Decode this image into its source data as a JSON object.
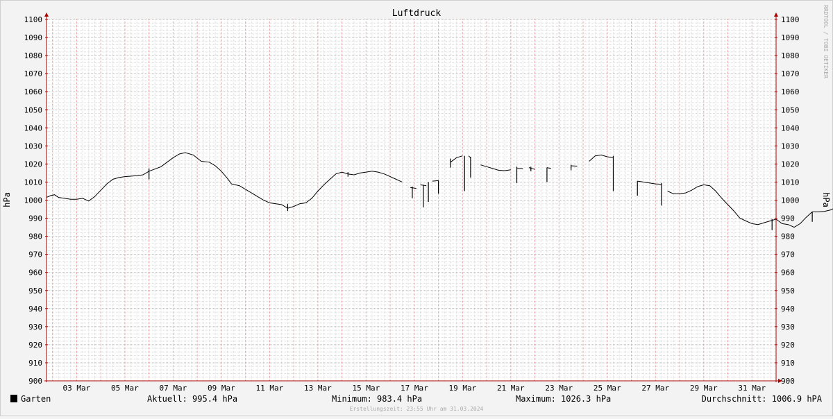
{
  "chart_data": {
    "type": "line",
    "title": "Luftdruck",
    "ylabel": "hPa",
    "ylim": [
      900,
      1100
    ],
    "yticks": [
      900,
      910,
      920,
      930,
      940,
      950,
      960,
      970,
      980,
      990,
      1000,
      1010,
      1020,
      1030,
      1040,
      1050,
      1060,
      1070,
      1080,
      1090,
      1100
    ],
    "xlim": [
      "2024-03-01T18:00",
      "2024-03-31T24:00"
    ],
    "xticks": [
      {
        "date": "2024-03-03",
        "label": "03 Mar"
      },
      {
        "date": "2024-03-05",
        "label": "05 Mar"
      },
      {
        "date": "2024-03-07",
        "label": "07 Mar"
      },
      {
        "date": "2024-03-09",
        "label": "09 Mar"
      },
      {
        "date": "2024-03-11",
        "label": "11 Mar"
      },
      {
        "date": "2024-03-13",
        "label": "13 Mar"
      },
      {
        "date": "2024-03-15",
        "label": "15 Mar"
      },
      {
        "date": "2024-03-17",
        "label": "17 Mar"
      },
      {
        "date": "2024-03-19",
        "label": "19 Mar"
      },
      {
        "date": "2024-03-21",
        "label": "21 Mar"
      },
      {
        "date": "2024-03-23",
        "label": "23 Mar"
      },
      {
        "date": "2024-03-25",
        "label": "25 Mar"
      },
      {
        "date": "2024-03-27",
        "label": "27 Mar"
      },
      {
        "date": "2024-03-29",
        "label": "29 Mar"
      },
      {
        "date": "2024-03-31",
        "label": "31 Mar"
      }
    ],
    "grid": true,
    "legend_position": "bottom-left",
    "series": [
      {
        "name": "Garten",
        "color": "#000000",
        "segments": [
          [
            [
              "2024-03-01T18:00",
              1001.5
            ],
            [
              "2024-03-01T22:00",
              1002.5
            ],
            [
              "2024-03-02T02:00",
              1003
            ],
            [
              "2024-03-02T06:00",
              1001.5
            ],
            [
              "2024-03-02T12:00",
              1001
            ],
            [
              "2024-03-02T18:00",
              1000.5
            ],
            [
              "2024-03-03T00:00",
              1000.5
            ],
            [
              "2024-03-03T06:00",
              1001
            ],
            [
              "2024-03-03T12:00",
              999.5
            ],
            [
              "2024-03-03T18:00",
              1002
            ],
            [
              "2024-03-04T00:00",
              1005.5
            ],
            [
              "2024-03-04T06:00",
              1009
            ],
            [
              "2024-03-04T12:00",
              1011.5
            ],
            [
              "2024-03-04T18:00",
              1012.5
            ],
            [
              "2024-03-05T00:00",
              1013
            ],
            [
              "2024-03-05T12:00",
              1013.5
            ],
            [
              "2024-03-05T18:00",
              1014
            ],
            [
              "2024-03-06T00:00",
              1016
            ],
            [
              "2024-03-06T12:00",
              1018.5
            ],
            [
              "2024-03-06T18:00",
              1021
            ],
            [
              "2024-03-07T00:00",
              1023.5
            ],
            [
              "2024-03-07T06:00",
              1025.5
            ],
            [
              "2024-03-07T12:00",
              1026.3
            ],
            [
              "2024-03-07T20:00",
              1025
            ],
            [
              "2024-03-08T04:00",
              1021.5
            ],
            [
              "2024-03-08T12:00",
              1021
            ],
            [
              "2024-03-08T18:00",
              1019
            ],
            [
              "2024-03-09T00:00",
              1016
            ],
            [
              "2024-03-09T06:00",
              1012
            ],
            [
              "2024-03-09T10:00",
              1009
            ],
            [
              "2024-03-09T18:00",
              1008
            ],
            [
              "2024-03-10T00:00",
              1006
            ],
            [
              "2024-03-10T06:00",
              1004
            ],
            [
              "2024-03-10T12:00",
              1002
            ],
            [
              "2024-03-10T18:00",
              1000
            ],
            [
              "2024-03-11T00:00",
              998.5
            ],
            [
              "2024-03-11T12:00",
              997.5
            ],
            [
              "2024-03-11T18:00",
              995.5
            ],
            [
              "2024-03-12T00:00",
              996.5
            ],
            [
              "2024-03-12T06:00",
              998
            ],
            [
              "2024-03-12T12:00",
              998.5
            ],
            [
              "2024-03-12T18:00",
              1001
            ],
            [
              "2024-03-13T00:00",
              1005
            ],
            [
              "2024-03-13T06:00",
              1008.5
            ],
            [
              "2024-03-13T12:00",
              1011.5
            ],
            [
              "2024-03-13T18:00",
              1014.5
            ],
            [
              "2024-03-14T00:00",
              1015.5
            ],
            [
              "2024-03-14T06:00",
              1014.5
            ],
            [
              "2024-03-14T12:00",
              1014
            ],
            [
              "2024-03-14T18:00",
              1015
            ],
            [
              "2024-03-15T00:00",
              1015.5
            ],
            [
              "2024-03-15T06:00",
              1016
            ],
            [
              "2024-03-15T12:00",
              1015.5
            ],
            [
              "2024-03-15T18:00",
              1014.5
            ],
            [
              "2024-03-16T00:00",
              1013
            ],
            [
              "2024-03-16T06:00",
              1011.5
            ],
            [
              "2024-03-16T12:00",
              1010
            ]
          ],
          [
            [
              "2024-03-16T20:00",
              1007
            ],
            [
              "2024-03-17T02:00",
              1006.5
            ]
          ],
          [
            [
              "2024-03-17T06:00",
              1008.5
            ],
            [
              "2024-03-17T12:00",
              1008
            ]
          ],
          [
            [
              "2024-03-17T18:00",
              1010.5
            ],
            [
              "2024-03-18T00:00",
              1010.8
            ]
          ],
          [
            [
              "2024-03-18T12:00",
              1021
            ],
            [
              "2024-03-18T18:00",
              1023.5
            ],
            [
              "2024-03-19T00:00",
              1024.5
            ]
          ],
          [
            [
              "2024-03-19T06:00",
              1024.5
            ],
            [
              "2024-03-19T08:00",
              1023.5
            ]
          ],
          [
            [
              "2024-03-19T18:00",
              1019.5
            ],
            [
              "2024-03-20T00:00",
              1018.5
            ],
            [
              "2024-03-20T06:00",
              1017.5
            ],
            [
              "2024-03-20T12:00",
              1016.5
            ],
            [
              "2024-03-20T18:00",
              1016.3
            ],
            [
              "2024-03-21T00:00",
              1016.8
            ]
          ],
          [
            [
              "2024-03-21T06:00",
              1017.5
            ],
            [
              "2024-03-21T12:00",
              1017.5
            ]
          ],
          [
            [
              "2024-03-21T18:00",
              1018
            ],
            [
              "2024-03-22T00:00",
              1017
            ]
          ],
          [
            [
              "2024-03-22T12:00",
              1018
            ],
            [
              "2024-03-22T16:00",
              1017.5
            ]
          ],
          [
            [
              "2024-03-23T12:00",
              1019
            ],
            [
              "2024-03-23T18:00",
              1018.8
            ]
          ],
          [
            [
              "2024-03-24T06:00",
              1021.5
            ],
            [
              "2024-03-24T12:00",
              1024.5
            ],
            [
              "2024-03-24T18:00",
              1025
            ],
            [
              "2024-03-25T00:00",
              1024
            ],
            [
              "2024-03-25T06:00",
              1023.5
            ]
          ],
          [
            [
              "2024-03-26T06:00",
              1010.5
            ],
            [
              "2024-03-26T12:00",
              1010
            ],
            [
              "2024-03-26T18:00",
              1009.5
            ],
            [
              "2024-03-27T00:00",
              1009
            ],
            [
              "2024-03-27T06:00",
              1008.8
            ]
          ],
          [
            [
              "2024-03-27T12:00",
              1005
            ],
            [
              "2024-03-27T18:00",
              1003.5
            ],
            [
              "2024-03-28T00:00",
              1003.5
            ],
            [
              "2024-03-28T06:00",
              1004
            ],
            [
              "2024-03-28T12:00",
              1005.5
            ],
            [
              "2024-03-28T18:00",
              1007.5
            ],
            [
              "2024-03-29T00:00",
              1008.5
            ],
            [
              "2024-03-29T06:00",
              1008
            ],
            [
              "2024-03-29T12:00",
              1005
            ],
            [
              "2024-03-29T18:00",
              1001
            ],
            [
              "2024-03-30T00:00",
              997.5
            ],
            [
              "2024-03-30T06:00",
              994
            ],
            [
              "2024-03-30T12:00",
              990
            ],
            [
              "2024-03-30T18:00",
              988.5
            ],
            [
              "2024-03-31T00:00",
              987
            ],
            [
              "2024-03-31T06:00",
              986.5
            ],
            [
              "2024-03-31T12:00",
              987.5
            ],
            [
              "2024-03-31T18:00",
              988.5
            ],
            [
              "2024-04-01T00:00",
              989.5
            ],
            [
              "2024-04-01T06:00",
              987
            ],
            [
              "2024-04-01T12:00",
              986.5
            ],
            [
              "2024-04-01T18:00",
              985
            ],
            [
              "2024-04-02T00:00",
              987
            ],
            [
              "2024-04-02T06:00",
              990.5
            ],
            [
              "2024-04-02T12:00",
              993.5
            ],
            [
              "2024-04-02T18:00",
              993.5
            ],
            [
              "2024-04-03T00:00",
              993.8
            ],
            [
              "2024-04-03T06:00",
              994.5
            ],
            [
              "2024-04-03T12:00",
              996
            ],
            [
              "2024-04-03T18:00",
              998.5
            ],
            [
              "2024-04-04T00:00",
              996.5
            ],
            [
              "2024-04-04T06:00",
              995.5
            ],
            [
              "2024-04-04T12:00",
              996
            ],
            [
              "2024-04-04T18:00",
              999.5
            ],
            [
              "2024-04-05T00:00",
              1000.5
            ],
            [
              "2024-04-05T06:00",
              1000.5
            ],
            [
              "2024-04-05T12:00",
              999
            ],
            [
              "2024-04-05T18:00",
              997
            ],
            [
              "2024-04-06T00:00",
              994.5
            ],
            [
              "2024-04-06T06:00",
              995.4
            ]
          ]
        ],
        "spikes": [
          [
            "2024-03-06T00:00",
            1017.5,
            1011.5
          ],
          [
            "2024-03-11T18:00",
            998,
            994
          ],
          [
            "2024-03-14T06:00",
            1015.5,
            1013
          ],
          [
            "2024-03-16T22:00",
            1007.5,
            1001
          ],
          [
            "2024-03-17T09:00",
            1008.5,
            996
          ],
          [
            "2024-03-17T14:00",
            1010,
            999
          ],
          [
            "2024-03-18T00:00",
            1011,
            1003.5
          ],
          [
            "2024-03-18T12:00",
            1023,
            1018
          ],
          [
            "2024-03-19T02:00",
            1024.5,
            1005
          ],
          [
            "2024-03-19T08:00",
            1024,
            1012.5
          ],
          [
            "2024-03-21T06:00",
            1018.5,
            1009.5
          ],
          [
            "2024-03-21T20:00",
            1018.5,
            1016
          ],
          [
            "2024-03-22T12:00",
            1018,
            1010
          ],
          [
            "2024-03-23T12:00",
            1019.5,
            1016.5
          ],
          [
            "2024-03-25T06:00",
            1024.5,
            1005
          ],
          [
            "2024-03-26T06:00",
            1010.5,
            1002.5
          ],
          [
            "2024-03-27T06:00",
            1009.5,
            997
          ],
          [
            "2024-03-31T20:00",
            989.5,
            983.4
          ],
          [
            "2024-04-02T12:00",
            993.5,
            988
          ]
        ]
      }
    ]
  },
  "legend": {
    "series_label": "Garten",
    "aktuell": "Aktuell: 995.4 hPa",
    "minimum": "Minimum: 983.4 hPa",
    "maximum": "Maximum: 1026.3 hPa",
    "durchschnitt": "Durchschnitt: 1006.9 hPA",
    "swatch_color": "#000000"
  },
  "footer": {
    "created": "Erstellungszeit: 23:55 Uhr am 31.03.2024"
  },
  "watermark": "RRDTOOL / TOBI OETIKER",
  "colors": {
    "background": "#f3f3f3",
    "plot_background": "#ffffff",
    "grid_minor": "#dcdcdc",
    "grid_major": "#e8a0a0",
    "axis": "#aa0000",
    "line": "#000000"
  }
}
